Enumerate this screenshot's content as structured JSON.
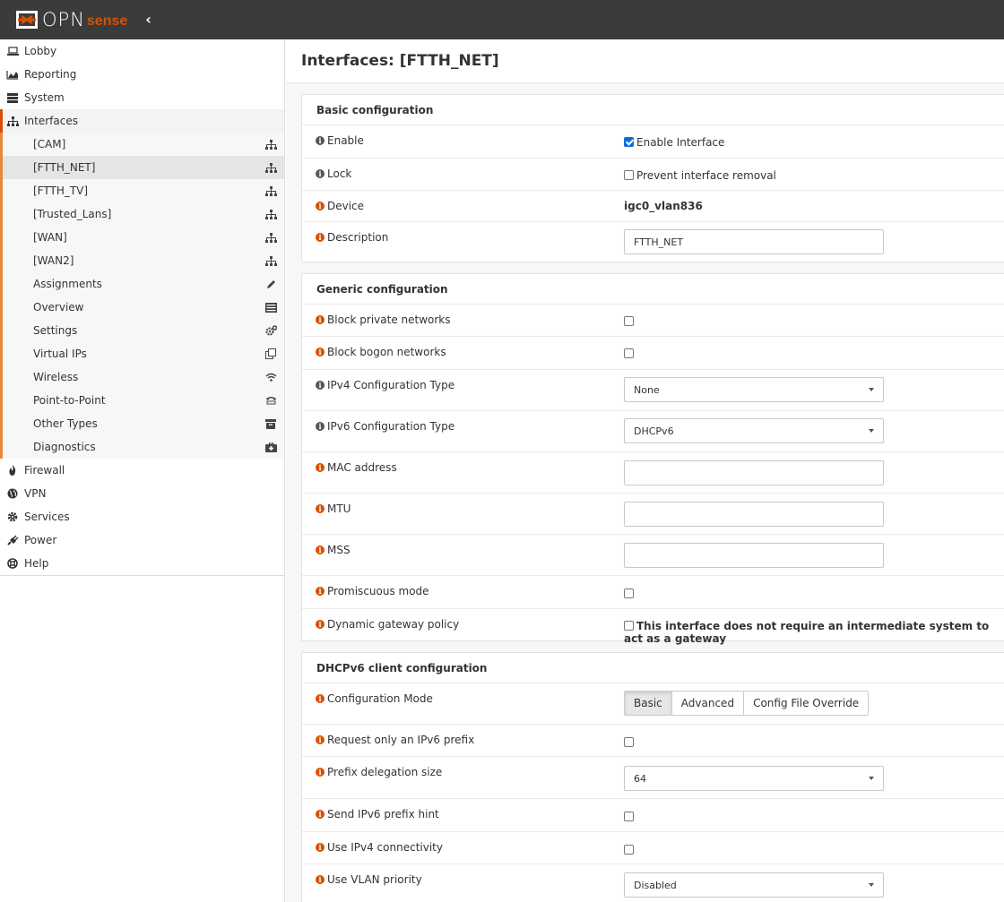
{
  "brand": {
    "logo_main": "OPN",
    "logo_sense": "sense"
  },
  "sidebar": {
    "items_top": [
      {
        "label": "Lobby",
        "icon": "laptop-icon"
      },
      {
        "label": "Reporting",
        "icon": "area-chart-icon"
      },
      {
        "label": "System",
        "icon": "server-icon"
      }
    ],
    "interfaces_label": "Interfaces",
    "sub_items": [
      {
        "label": "[CAM]",
        "icon": "sitemap-icon"
      },
      {
        "label": "[FTTH_NET]",
        "icon": "sitemap-icon"
      },
      {
        "label": "[FTTH_TV]",
        "icon": "sitemap-icon"
      },
      {
        "label": "[Trusted_Lans]",
        "icon": "sitemap-icon"
      },
      {
        "label": "[WAN]",
        "icon": "sitemap-icon"
      },
      {
        "label": "[WAN2]",
        "icon": "sitemap-icon"
      },
      {
        "label": "Assignments",
        "icon": "pencil-icon"
      },
      {
        "label": "Overview",
        "icon": "tasks-icon"
      },
      {
        "label": "Settings",
        "icon": "cogs-icon"
      },
      {
        "label": "Virtual IPs",
        "icon": "clone-icon"
      },
      {
        "label": "Wireless",
        "icon": "wifi-icon"
      },
      {
        "label": "Point-to-Point",
        "icon": "tty-icon"
      },
      {
        "label": "Other Types",
        "icon": "archive-icon"
      },
      {
        "label": "Diagnostics",
        "icon": "medkit-icon"
      }
    ],
    "items_bottom": [
      {
        "label": "Firewall",
        "icon": "fire-icon"
      },
      {
        "label": "VPN",
        "icon": "globe-icon"
      },
      {
        "label": "Services",
        "icon": "cog-icon"
      },
      {
        "label": "Power",
        "icon": "plug-icon"
      },
      {
        "label": "Help",
        "icon": "life-ring-icon"
      }
    ]
  },
  "page": {
    "title": "Interfaces: [FTTH_NET]"
  },
  "basic": {
    "title": "Basic configuration",
    "enable_label": "Enable",
    "enable_text": "Enable Interface",
    "lock_label": "Lock",
    "lock_text": "Prevent interface removal",
    "device_label": "Device",
    "device_value": "igc0_vlan836",
    "description_label": "Description",
    "description_value": "FTTH_NET"
  },
  "generic": {
    "title": "Generic configuration",
    "block_private_label": "Block private networks",
    "block_bogon_label": "Block bogon networks",
    "ipv4_type_label": "IPv4 Configuration Type",
    "ipv4_type_value": "None",
    "ipv6_type_label": "IPv6 Configuration Type",
    "ipv6_type_value": "DHCPv6",
    "mac_label": "MAC address",
    "mtu_label": "MTU",
    "mss_label": "MSS",
    "promisc_label": "Promiscuous mode",
    "dyn_gw_label": "Dynamic gateway policy",
    "dyn_gw_text": "This interface does not require an intermediate system to act as a gateway"
  },
  "dhcpv6": {
    "title": "DHCPv6 client configuration",
    "mode_label": "Configuration Mode",
    "mode_basic": "Basic",
    "mode_advanced": "Advanced",
    "mode_override": "Config File Override",
    "prefix_only_label": "Request only an IPv6 prefix",
    "pd_size_label": "Prefix delegation size",
    "pd_size_value": "64",
    "prefix_hint_label": "Send IPv6 prefix hint",
    "use_ipv4_label": "Use IPv4 connectivity",
    "vlan_prio_label": "Use VLAN priority",
    "vlan_prio_value": "Disabled"
  },
  "colors": {
    "brand_orange": "#d94f00",
    "topbar": "#3b3b3b",
    "accent_border": "#e58a3a"
  }
}
